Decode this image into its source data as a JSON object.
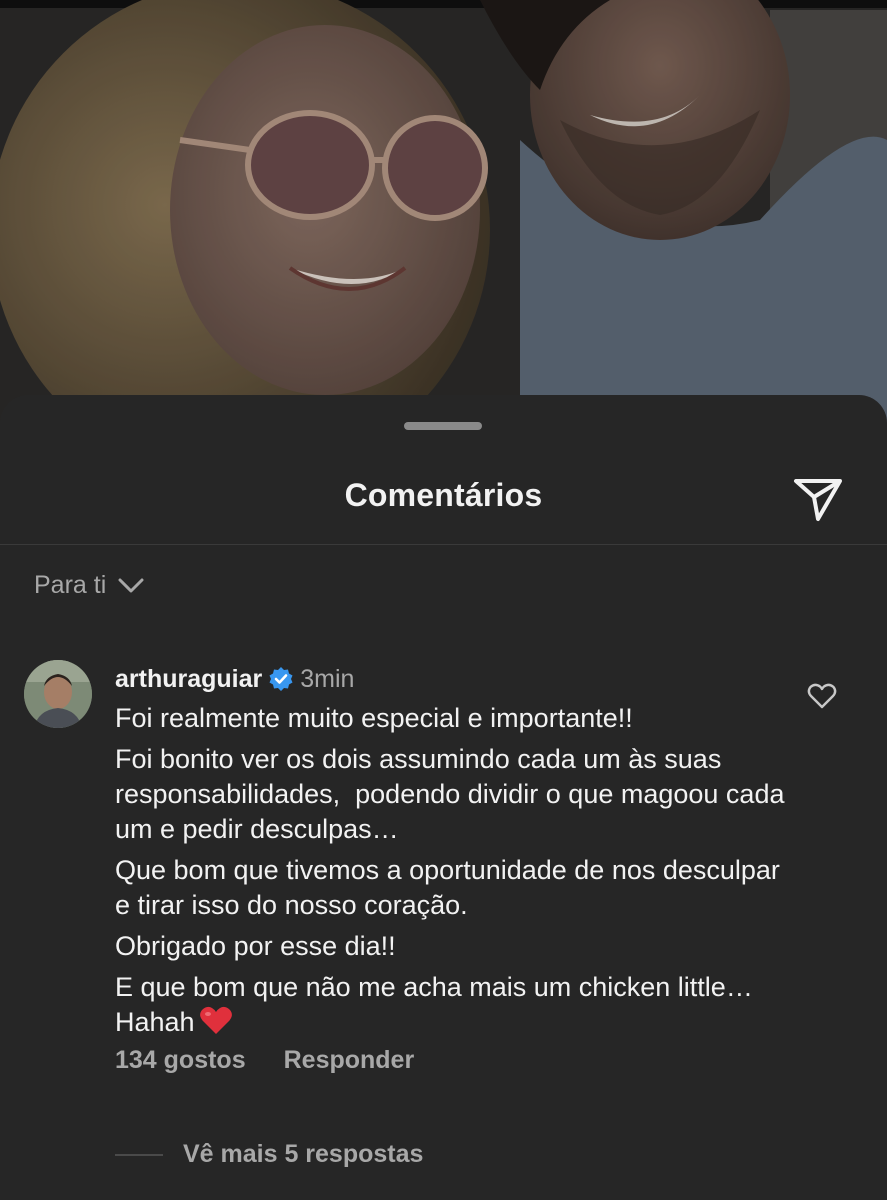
{
  "sheet": {
    "title": "Comentários"
  },
  "sort": {
    "label": "Para ti"
  },
  "comment": {
    "username": "arthuraguiar",
    "time": "3min",
    "paragraphs": [
      "Foi realmente muito especial e importante!!",
      "Foi bonito ver os dois assumindo cada um às suas responsabilidades,  podendo dividir o que magoou cada um e pedir desculpas…",
      "Que bom que tivemos a oportunidade de nos desculpar e tirar isso do nosso coração.",
      "Obrigado por esse dia!!"
    ],
    "last_paragraph": "E que bom que não me acha mais um chicken little… Hahah",
    "likes": "134 gostos",
    "reply": "Responder",
    "more_replies": "Vê mais 5 respostas"
  },
  "icons": {
    "share": "paper-plane-icon",
    "sort_toggle": "chevron-down-icon",
    "verified": "verified-badge-icon",
    "like": "heart-outline-icon",
    "emoji": "red-heart-emoji"
  },
  "colors": {
    "sheet_bg": "#262626",
    "text": "#f2f2f2",
    "muted": "#a8a8a8",
    "verified": "#3897f0",
    "heart_emoji": "#e0303c"
  }
}
